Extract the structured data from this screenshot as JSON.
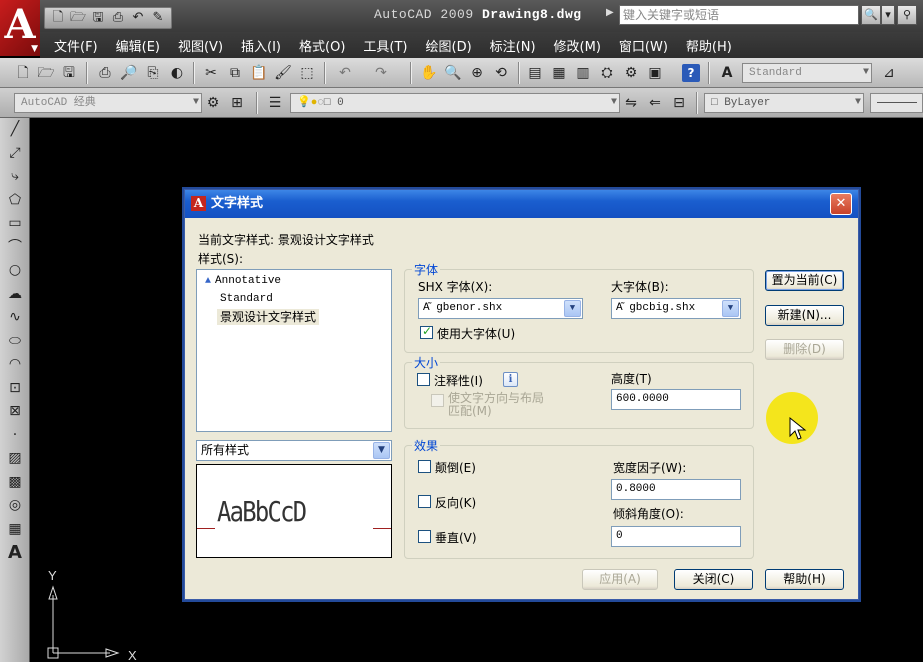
{
  "app": {
    "logo": "A",
    "title_prefix": "AutoCAD 2009",
    "doc_name": "Drawing8.dwg",
    "search_placeholder": "键入关键字或短语",
    "menu": [
      "文件(F)",
      "编辑(E)",
      "视图(V)",
      "插入(I)",
      "格式(O)",
      "工具(T)",
      "绘图(D)",
      "标注(N)",
      "修改(M)",
      "窗口(W)",
      "帮助(H)"
    ],
    "toolbar": {
      "text_style_combo": "Standard",
      "workspace_combo": "AutoCAD 经典",
      "layer_combo": "0",
      "color_combo": "ByLayer"
    },
    "ucs": {
      "y_label": "Y",
      "x_label": "X"
    }
  },
  "dialog": {
    "title": "文字样式",
    "current_style_label": "当前文字样式:",
    "current_style_value": "景观设计文字样式",
    "styles_label": "样式(S):",
    "styles": [
      {
        "name": "Annotative",
        "annotative": true
      },
      {
        "name": "Standard",
        "annotative": false
      },
      {
        "name": "景观设计文字样式",
        "annotative": false,
        "selected": true
      }
    ],
    "filter_value": "所有样式",
    "preview_text": "AaBbCcD",
    "font_group": {
      "title": "字体",
      "shx_label": "SHX 字体(X):",
      "shx_value": "gbenor.shx",
      "big_label": "大字体(B):",
      "big_value": "gbcbig.shx",
      "use_big_font_label": "使用大字体(U)",
      "use_big_font": true
    },
    "size_group": {
      "title": "大小",
      "annotative_label": "注释性(I)",
      "annotative": false,
      "match_orientation_label_1": "使文字方向与布局",
      "match_orientation_label_2": "匹配(M)",
      "height_label": "高度(T)",
      "height_value": "600.0000"
    },
    "effects_group": {
      "title": "效果",
      "upside_down_label": "颠倒(E)",
      "backwards_label": "反向(K)",
      "vertical_label": "垂直(V)",
      "width_factor_label": "宽度因子(W):",
      "width_factor_value": "0.8000",
      "oblique_label": "倾斜角度(O):",
      "oblique_value": "0"
    },
    "buttons": {
      "set_current": "置为当前(C)",
      "new": "新建(N)...",
      "delete": "删除(D)",
      "apply": "应用(A)",
      "close": "关闭(C)",
      "help": "帮助(H)"
    }
  }
}
